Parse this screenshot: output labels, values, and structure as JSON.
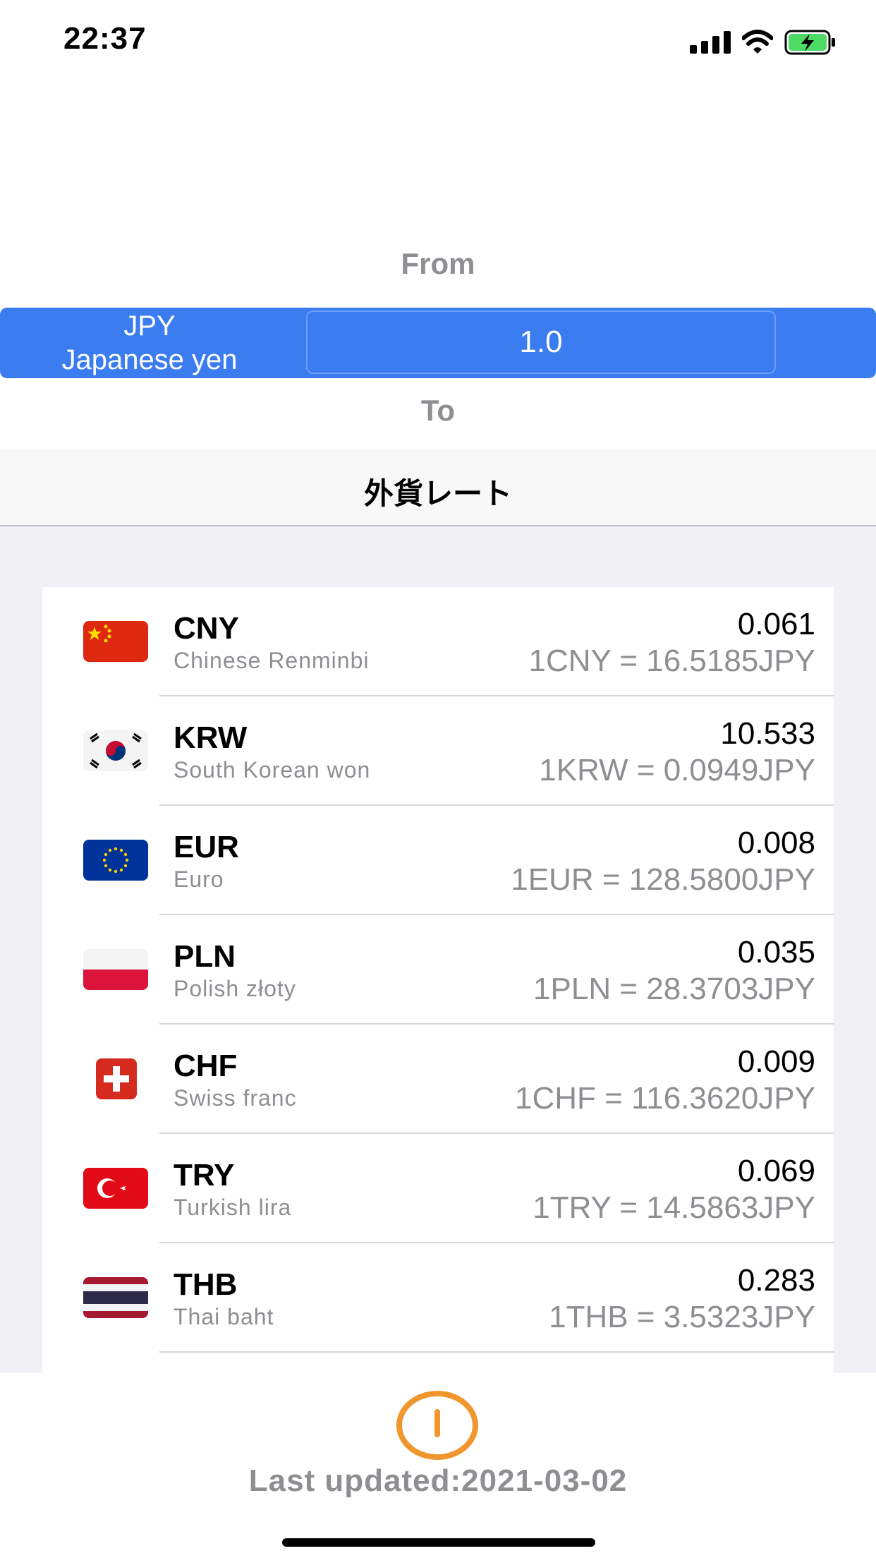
{
  "status_bar": {
    "time": "22:37",
    "signal_icon": "cellular-signal-icon",
    "wifi_icon": "wifi-icon",
    "battery_icon": "battery-charging-icon",
    "battery_color": "#4cd964"
  },
  "converter": {
    "from_label": "From",
    "to_label": "To",
    "base_code": "JPY",
    "base_name": "Japanese yen",
    "amount": "1.0",
    "accent_color": "#3b7cf0"
  },
  "nav": {
    "title": "外貨レート"
  },
  "rates": [
    {
      "code": "CNY",
      "name": "Chinese Renminbi",
      "rate": "0.061",
      "conversion": "1CNY = 16.5185JPY",
      "flag_icon": "china-flag-icon"
    },
    {
      "code": "KRW",
      "name": "South Korean won",
      "rate": "10.533",
      "conversion": "1KRW = 0.0949JPY",
      "flag_icon": "south-korea-flag-icon"
    },
    {
      "code": "EUR",
      "name": "Euro",
      "rate": "0.008",
      "conversion": "1EUR = 128.5800JPY",
      "flag_icon": "eu-flag-icon"
    },
    {
      "code": "PLN",
      "name": "Polish złoty",
      "rate": "0.035",
      "conversion": "1PLN = 28.3703JPY",
      "flag_icon": "poland-flag-icon"
    },
    {
      "code": "CHF",
      "name": "Swiss franc",
      "rate": "0.009",
      "conversion": "1CHF = 116.3620JPY",
      "flag_icon": "switzerland-flag-icon"
    },
    {
      "code": "TRY",
      "name": "Turkish lira",
      "rate": "0.069",
      "conversion": "1TRY = 14.5863JPY",
      "flag_icon": "turkey-flag-icon"
    },
    {
      "code": "THB",
      "name": "Thai baht",
      "rate": "0.283",
      "conversion": "1THB = 3.5323JPY",
      "flag_icon": "thailand-flag-icon"
    }
  ],
  "footer": {
    "last_updated": "Last updated:2021-03-02",
    "info_icon": "info-icon",
    "info_color": "#f0962d"
  }
}
